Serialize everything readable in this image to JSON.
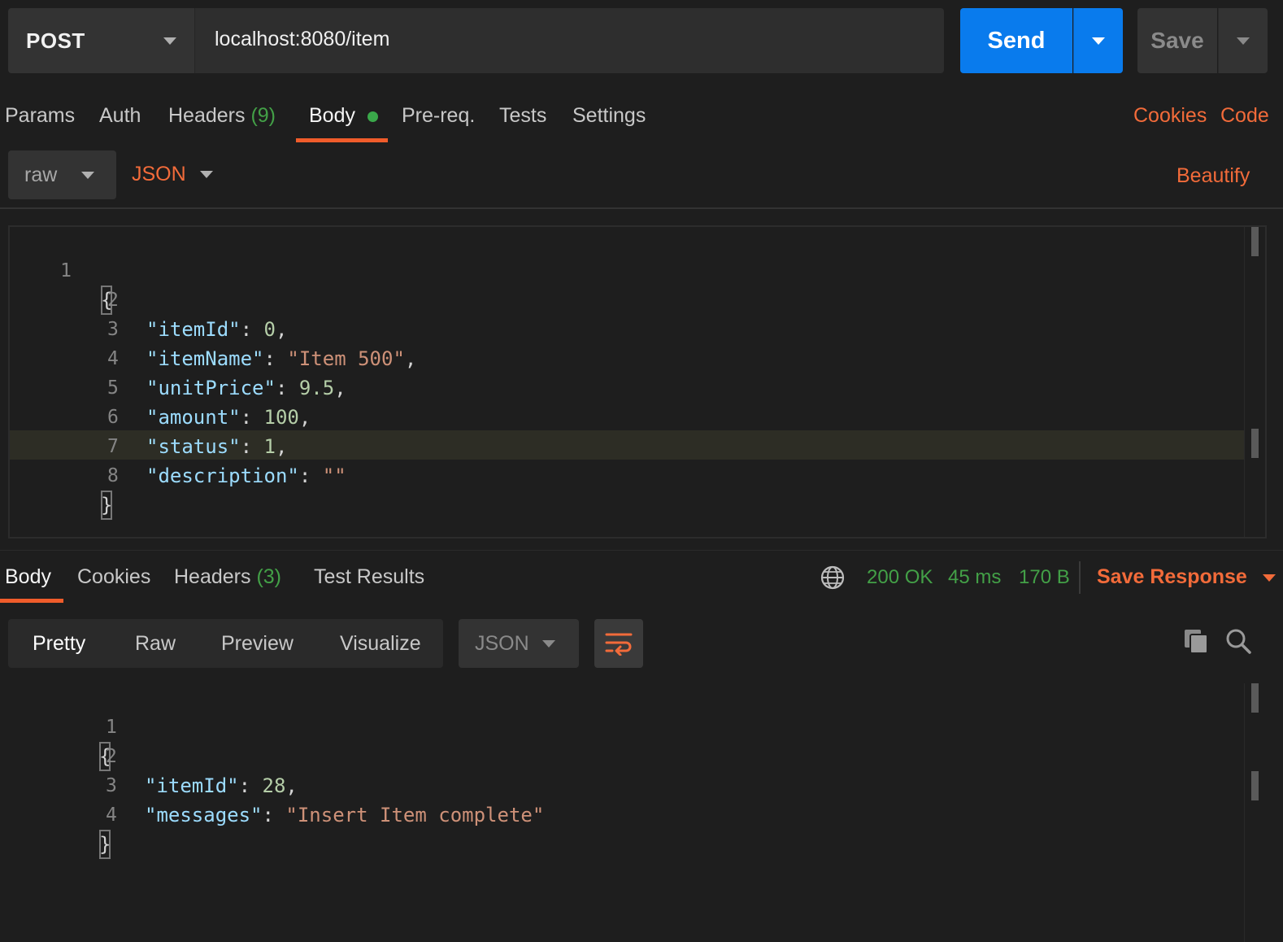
{
  "request": {
    "method": "POST",
    "url": "localhost:8080/item",
    "send_label": "Send",
    "save_label": "Save"
  },
  "request_tabs": [
    {
      "label": "Params"
    },
    {
      "label": "Auth"
    },
    {
      "label": "Headers",
      "count": "(9)"
    },
    {
      "label": "Body",
      "active": true
    },
    {
      "label": "Pre-req."
    },
    {
      "label": "Tests"
    },
    {
      "label": "Settings"
    }
  ],
  "right_links": {
    "cookies": "Cookies",
    "code": "Code"
  },
  "body_options": {
    "mode": "raw",
    "language": "JSON",
    "beautify": "Beautify"
  },
  "request_body": {
    "line_numbers": [
      "1",
      "2",
      "3",
      "4",
      "5",
      "6",
      "7",
      "8"
    ],
    "open_brace": "{",
    "close_brace": "}",
    "fields": [
      {
        "key": "\"itemId\"",
        "colon": ": ",
        "value": "0",
        "type": "n",
        "comma": ","
      },
      {
        "key": "\"itemName\"",
        "colon": ": ",
        "value": "\"Item 500\"",
        "type": "s",
        "comma": ","
      },
      {
        "key": "\"unitPrice\"",
        "colon": ": ",
        "value": "9.5",
        "type": "n",
        "comma": ","
      },
      {
        "key": "\"amount\"",
        "colon": ": ",
        "value": "100",
        "type": "n",
        "comma": ","
      },
      {
        "key": "\"status\"",
        "colon": ": ",
        "value": "1",
        "type": "n",
        "comma": ","
      },
      {
        "key": "\"description\"",
        "colon": ": ",
        "value": "\"\"",
        "type": "s",
        "comma": ""
      }
    ]
  },
  "response_tabs": [
    {
      "label": "Body",
      "active": true
    },
    {
      "label": "Cookies"
    },
    {
      "label": "Headers",
      "count": "(3)"
    },
    {
      "label": "Test Results"
    }
  ],
  "response_status": {
    "status": "200 OK",
    "time": "45 ms",
    "size": "170 B",
    "save_response": "Save Response"
  },
  "response_view": {
    "modes": [
      "Pretty",
      "Raw",
      "Preview",
      "Visualize"
    ],
    "active_mode": "Pretty",
    "language": "JSON"
  },
  "response_body": {
    "line_numbers": [
      "1",
      "2",
      "3",
      "4"
    ],
    "open_brace": "{",
    "close_brace": "}",
    "fields": [
      {
        "key": "\"itemId\"",
        "colon": ": ",
        "value": "28",
        "type": "n",
        "comma": ","
      },
      {
        "key": "\"messages\"",
        "colon": ": ",
        "value": "\"Insert Item complete\"",
        "type": "s",
        "comma": ""
      }
    ]
  },
  "colors": {
    "accent_orange": "#f26b3a",
    "send_blue": "#097bed",
    "status_green": "#43a047"
  }
}
